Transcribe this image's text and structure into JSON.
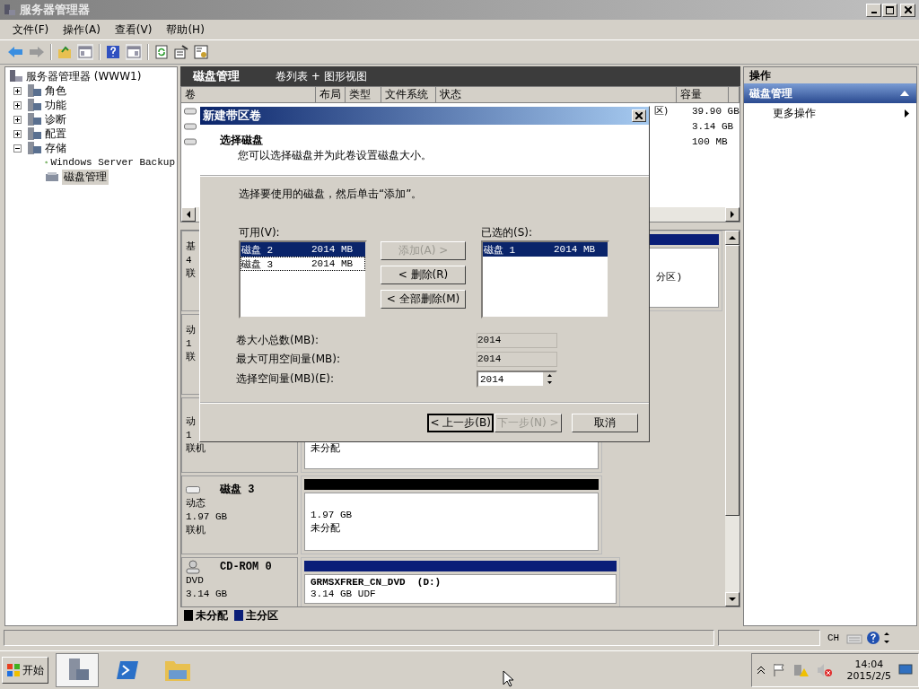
{
  "window": {
    "title": "服务器管理器"
  },
  "menu": [
    "文件(F)",
    "操作(A)",
    "查看(V)",
    "帮助(H)"
  ],
  "tree": {
    "root": "服务器管理器 (WWW1)",
    "items": [
      {
        "label": "角色",
        "expanded": false
      },
      {
        "label": "功能",
        "expanded": false
      },
      {
        "label": "诊断",
        "expanded": false
      },
      {
        "label": "配置",
        "expanded": false
      },
      {
        "label": "存储",
        "expanded": true,
        "children": [
          {
            "label": "Windows Server Backup",
            "selected": false
          },
          {
            "label": "磁盘管理",
            "selected": true
          }
        ]
      }
    ]
  },
  "center": {
    "title": "磁盘管理",
    "view": "卷列表 + 图形视图"
  },
  "table": {
    "columns": [
      "卷",
      "布局",
      "类型",
      "文件系统",
      "状态",
      "容量"
    ],
    "rows": [
      {
        "status": "区)",
        "capacity": "39.90 GB"
      },
      {
        "capacity": "3.14 GB"
      },
      {
        "capacity": "100 MB"
      }
    ]
  },
  "disks": [
    {
      "kind": "covered",
      "lines": [
        "基",
        "4",
        "联"
      ],
      "color": "#0a1e78",
      "partition": [
        "分区)"
      ]
    },
    {
      "kind": "covered",
      "lines": [
        "动",
        "1",
        "联"
      ]
    },
    {
      "kind": "covered",
      "lines": [
        "动",
        "1",
        "联机"
      ],
      "partition": [
        "未分配"
      ]
    },
    {
      "kind": "disk",
      "name": "磁盘 3",
      "lines": [
        "动态",
        "1.97 GB",
        "联机"
      ],
      "color": "#000000",
      "partition": [
        "1.97 GB",
        "未分配"
      ]
    },
    {
      "kind": "cdrom",
      "name": "CD-ROM 0",
      "lines": [
        "DVD",
        "3.14 GB"
      ],
      "color": "#0a1e78",
      "partition_title": "GRMSXFRER_CN_DVD  (D:)",
      "partition": [
        "3.14 GB UDF"
      ]
    }
  ],
  "legend": [
    {
      "label": "未分配",
      "color": "#000000"
    },
    {
      "label": "主分区",
      "color": "#0a1e78"
    }
  ],
  "actions": {
    "title": "操作",
    "section": "磁盘管理",
    "items": [
      "更多操作"
    ]
  },
  "language_bar": {
    "code": "CH"
  },
  "taskbar": {
    "start": "开始",
    "time": "14:04",
    "date": "2015/2/5"
  },
  "dialog": {
    "title": "新建带区卷",
    "heading": "选择磁盘",
    "subtitle": "您可以选择磁盘并为此卷设置磁盘大小。",
    "instruction": "选择要使用的磁盘，然后单击“添加”。",
    "available": {
      "label": "可用(V):",
      "items": [
        {
          "name": "磁盘 2",
          "size": "2014 MB",
          "selected": true,
          "focused": false
        },
        {
          "name": "磁盘 3",
          "size": "2014 MB",
          "selected": false,
          "focused": true
        }
      ]
    },
    "chosen": {
      "label": "已选的(S):",
      "items": [
        {
          "name": "磁盘 1",
          "size": "2014 MB",
          "selected": true,
          "focused": false
        }
      ]
    },
    "move_buttons": [
      {
        "label": "添加(A) >",
        "disabled": true
      },
      {
        "label": "< 删除(R)",
        "disabled": false
      },
      {
        "label": "< 全部删除(M)",
        "disabled": false
      }
    ],
    "fields": [
      {
        "label": "卷大小总数(MB):",
        "value": "2014",
        "kind": "readonly"
      },
      {
        "label": "最大可用空间量(MB):",
        "value": "2014",
        "kind": "readonly"
      },
      {
        "label": "选择空间量(MB)(E):",
        "value": "2014",
        "kind": "spinner"
      }
    ],
    "nav_buttons": [
      {
        "label": "< 上一步(B)",
        "disabled": false
      },
      {
        "label": "下一步(N) >",
        "disabled": true
      },
      {
        "label": "取消",
        "disabled": false
      }
    ]
  }
}
